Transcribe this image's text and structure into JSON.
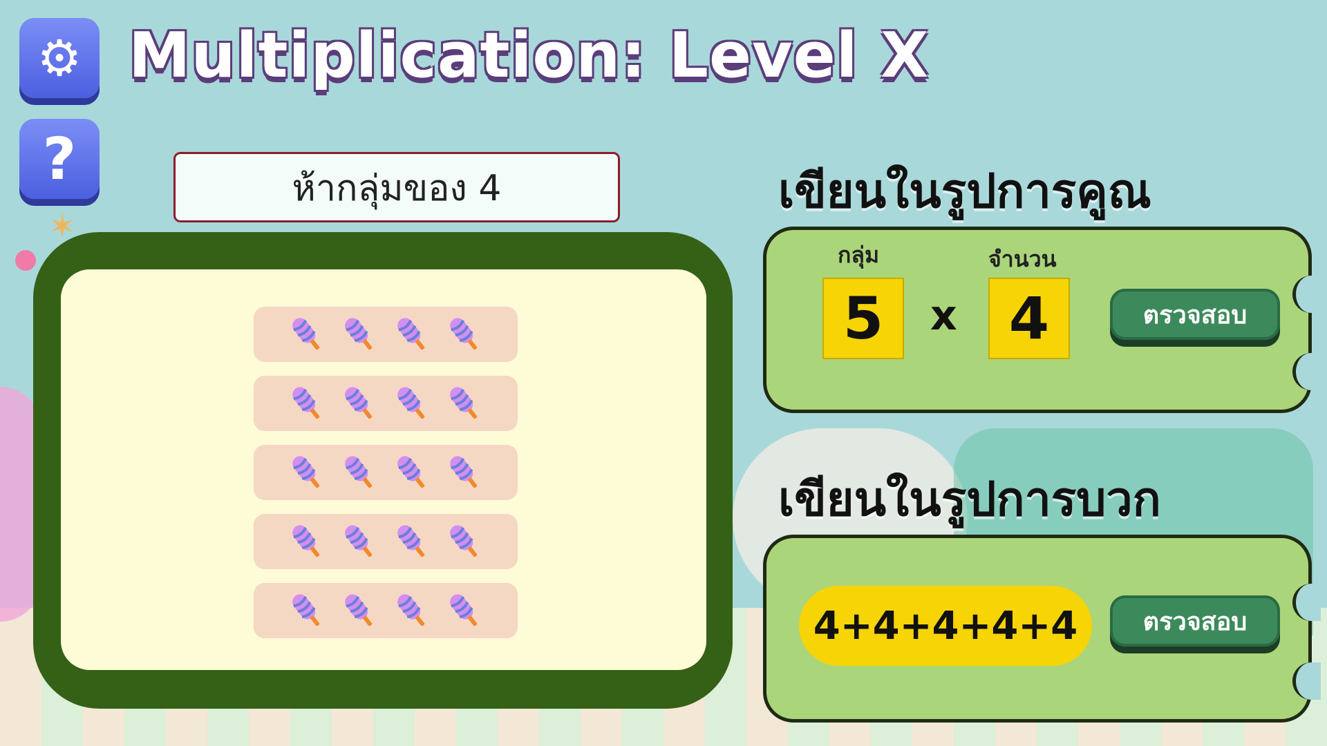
{
  "title": "Multiplication: Level X",
  "buttons": {
    "settings_icon": "gear-icon",
    "help_icon": "question-icon",
    "help_glyph": "?"
  },
  "prompt": "ห้ากลุ่มของ 4",
  "popsicle_groups": {
    "groups": 5,
    "per_group": 4
  },
  "multiplication": {
    "title": "เขียนในรูปการคูณ",
    "groups_label": "กลุ่ม",
    "amount_label": "จำนวน",
    "groups_value": "5",
    "operator": "x",
    "amount_value": "4",
    "check_label": "ตรวจสอบ"
  },
  "addition": {
    "title": "เขียนในรูปการบวก",
    "answer": "4+4+4+4+4",
    "check_label": "ตรวจสอบ"
  },
  "colors": {
    "board_border": "#356117",
    "board_fill": "#fefbd7",
    "panel": "#abd57a",
    "answer_yellow": "#f6d406",
    "check_button": "#3c8a5b",
    "icon_button": "#5a6ce8"
  }
}
